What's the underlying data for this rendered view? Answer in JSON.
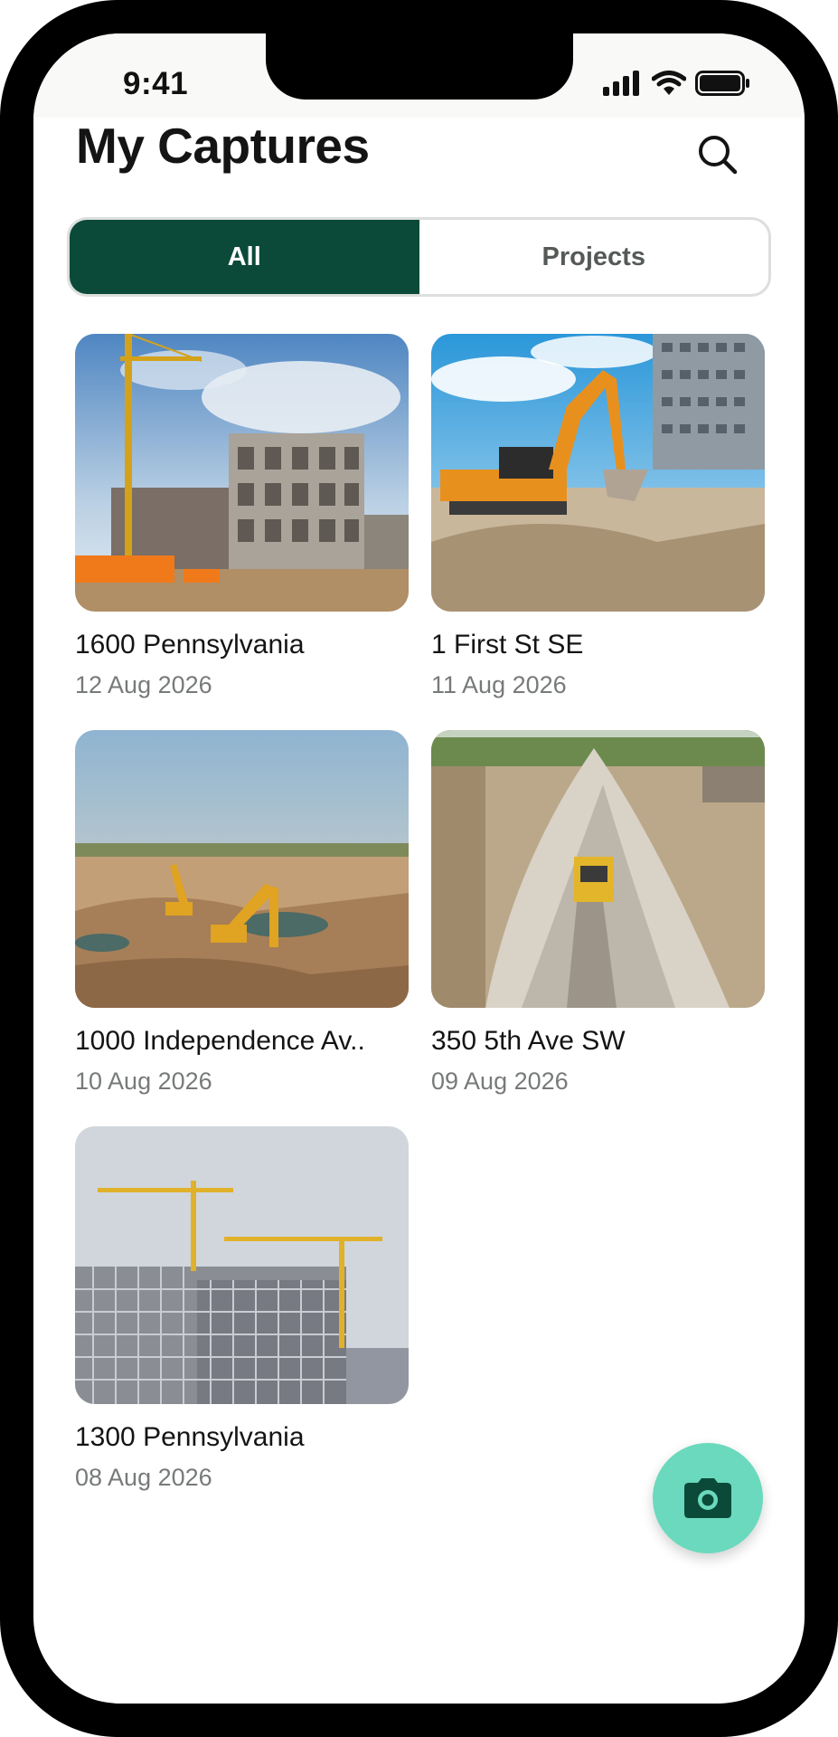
{
  "status_bar": {
    "time": "9:41",
    "icons": [
      "cellular-signal-icon",
      "wifi-icon",
      "battery-icon"
    ]
  },
  "header": {
    "title": "My Captures",
    "search_icon": "search-icon"
  },
  "tabs": [
    {
      "label": "All",
      "active": true
    },
    {
      "label": "Projects",
      "active": false
    }
  ],
  "captures": [
    {
      "title": "1600 Pennsylvania",
      "date": "12 Aug 2026",
      "scene": "concrete building frame with tower crane"
    },
    {
      "title": "1 First St SE",
      "date": "11 Aug 2026",
      "scene": "orange excavator digging"
    },
    {
      "title": "1000 Independence Av..",
      "date": "10 Aug 2026",
      "scene": "excavators on dirt field"
    },
    {
      "title": "350 5th Ave SW",
      "date": "09 Aug 2026",
      "scene": "aerial gravel pile with bulldozer"
    },
    {
      "title": "1300 Pennsylvania",
      "date": "08 Aug 2026",
      "scene": "high-rise frame with two cranes"
    }
  ],
  "fab": {
    "icon": "camera-icon"
  },
  "colors": {
    "accent_dark": "#0b4a39",
    "fab": "#6ad9bd",
    "text_primary": "#141414",
    "text_secondary": "#777b78"
  }
}
